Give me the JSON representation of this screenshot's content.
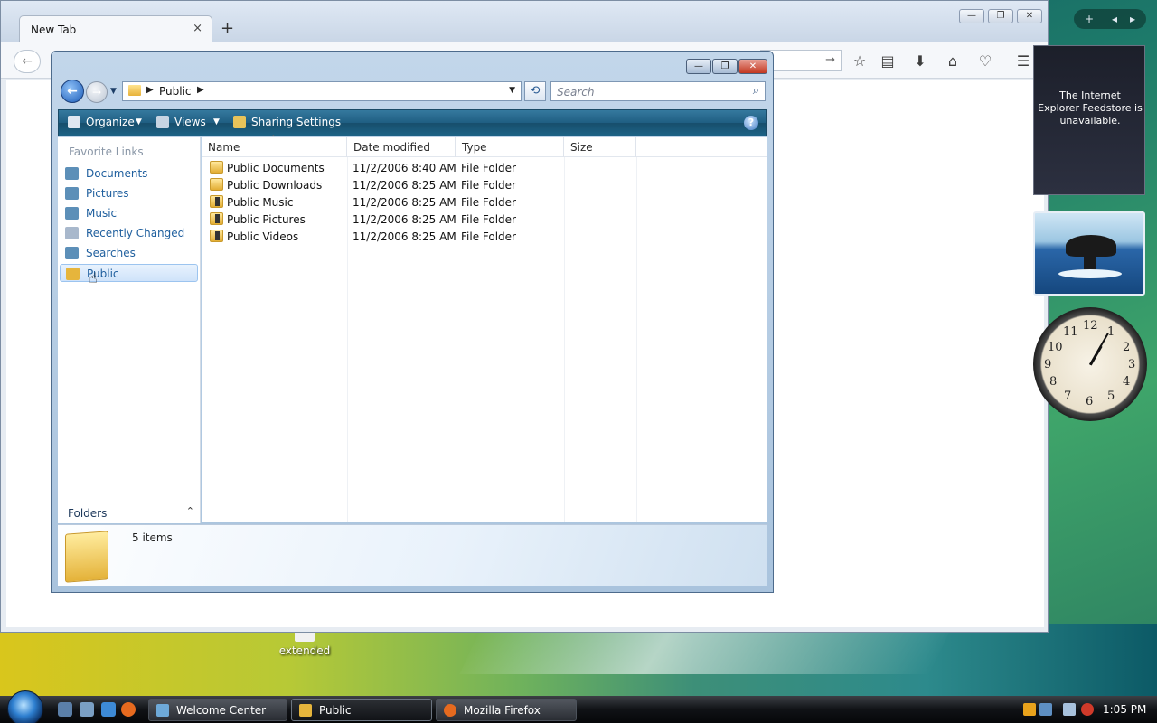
{
  "firefox": {
    "tab_title": "New Tab",
    "tab_close": "×",
    "new_tab": "+",
    "caption_min": "—",
    "caption_max": "❐",
    "caption_close": "✕",
    "back_icon": "←",
    "go_icon": "→"
  },
  "explorer": {
    "caption_min": "—",
    "caption_max": "❐",
    "caption_close": "✕",
    "address": "Public",
    "search_placeholder": "Search",
    "toolbar": {
      "organize": "Organize",
      "views": "Views",
      "sharing": "Sharing Settings",
      "help": "?"
    },
    "nav": {
      "heading": "Favorite Links",
      "items": [
        {
          "label": "Documents",
          "icon": "documents-icon",
          "color": "#5c8fb8"
        },
        {
          "label": "Pictures",
          "icon": "pictures-icon",
          "color": "#5c8fb8"
        },
        {
          "label": "Music",
          "icon": "music-icon",
          "color": "#5c8fb8"
        },
        {
          "label": "Recently Changed",
          "icon": "recently-changed-icon",
          "color": "#a8b8cc"
        },
        {
          "label": "Searches",
          "icon": "searches-icon",
          "color": "#5c8fb8"
        },
        {
          "label": "Public",
          "icon": "folder-icon",
          "color": "#e6b53c",
          "selected": true
        }
      ],
      "folders_label": "Folders",
      "folders_arrow": "⌃"
    },
    "columns": [
      "Name",
      "Date modified",
      "Type",
      "Size"
    ],
    "rows": [
      {
        "name": "Public Documents",
        "date": "11/2/2006 8:40 AM",
        "type": "File Folder",
        "size": ""
      },
      {
        "name": "Public Downloads",
        "date": "11/2/2006 8:25 AM",
        "type": "File Folder",
        "size": ""
      },
      {
        "name": "Public Music",
        "date": "11/2/2006 8:25 AM",
        "type": "File Folder",
        "size": ""
      },
      {
        "name": "Public Pictures",
        "date": "11/2/2006 8:25 AM",
        "type": "File Folder",
        "size": ""
      },
      {
        "name": "Public Videos",
        "date": "11/2/2006 8:25 AM",
        "type": "File Folder",
        "size": ""
      }
    ],
    "status": "5 items"
  },
  "sidebar": {
    "feed_text": "The Internet Explorer Feedstore is unavailable.",
    "clock_numbers": [
      "12",
      "1",
      "2",
      "3",
      "4",
      "5",
      "6",
      "7",
      "8",
      "9",
      "10",
      "11"
    ]
  },
  "desktop": {
    "icon_label": "extended"
  },
  "taskbar": {
    "buttons": [
      {
        "label": "Welcome Center",
        "icon_color": "#6ea9d8"
      },
      {
        "label": "Public",
        "icon_color": "#e6b53c",
        "active": true
      },
      {
        "label": "Mozilla Firefox",
        "icon_color": "#e66a1f"
      }
    ],
    "time": "1:05 PM"
  }
}
